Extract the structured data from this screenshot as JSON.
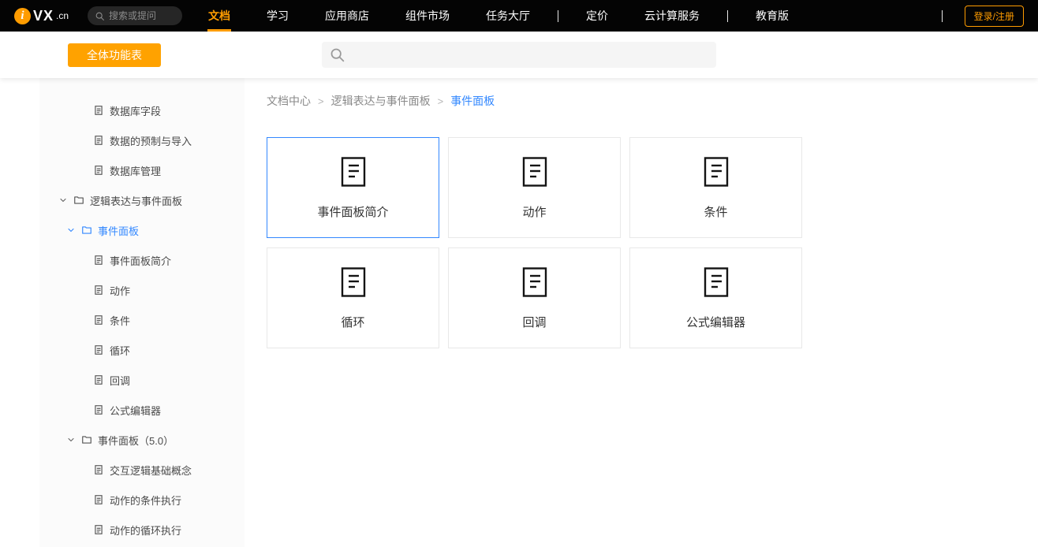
{
  "topnav": {
    "logo": {
      "icon_letter": "i",
      "brand": "VX",
      "domain": ".cn"
    },
    "search_placeholder": "搜索或提问",
    "items": [
      {
        "label": "文档",
        "active": true
      },
      {
        "label": "学习"
      },
      {
        "label": "应用商店"
      },
      {
        "label": "组件市场"
      },
      {
        "label": "任务大厅"
      },
      {
        "divider": true
      },
      {
        "label": "定价"
      },
      {
        "label": "云计算服务"
      },
      {
        "divider": true
      },
      {
        "label": "教育版"
      }
    ],
    "login_label": "登录/注册"
  },
  "subheader": {
    "all_features_label": "全体功能表",
    "search_value": ""
  },
  "sidebar": {
    "items": [
      {
        "label": "数据库字段",
        "type": "doc",
        "level": 2
      },
      {
        "label": "数据的预制与导入",
        "type": "doc",
        "level": 2
      },
      {
        "label": "数据库管理",
        "type": "doc",
        "level": 2
      },
      {
        "label": "逻辑表达与事件面板",
        "type": "folder",
        "level": 0,
        "expanded": true
      },
      {
        "label": "事件面板",
        "type": "folder",
        "level": 1,
        "expanded": true,
        "active": true
      },
      {
        "label": "事件面板简介",
        "type": "doc",
        "level": 2
      },
      {
        "label": "动作",
        "type": "doc",
        "level": 2
      },
      {
        "label": "条件",
        "type": "doc",
        "level": 2
      },
      {
        "label": "循环",
        "type": "doc",
        "level": 2
      },
      {
        "label": "回调",
        "type": "doc",
        "level": 2
      },
      {
        "label": "公式编辑器",
        "type": "doc",
        "level": 2
      },
      {
        "label": "事件面板（5.0）",
        "type": "folder",
        "level": 1,
        "expanded": true
      },
      {
        "label": "交互逻辑基础概念",
        "type": "doc",
        "level": 2
      },
      {
        "label": "动作的条件执行",
        "type": "doc",
        "level": 2
      },
      {
        "label": "动作的循环执行",
        "type": "doc",
        "level": 2
      }
    ]
  },
  "breadcrumb": {
    "items": [
      "文档中心",
      "逻辑表达与事件面板",
      "事件面板"
    ]
  },
  "cards": [
    {
      "label": "事件面板简介",
      "selected": true
    },
    {
      "label": "动作"
    },
    {
      "label": "条件"
    },
    {
      "label": "循环"
    },
    {
      "label": "回调"
    },
    {
      "label": "公式编辑器"
    }
  ],
  "colors": {
    "accent_orange": "#ff9c00",
    "button_orange": "#ffa200",
    "link_blue": "#3388ff",
    "navbar_bg": "#040404"
  }
}
